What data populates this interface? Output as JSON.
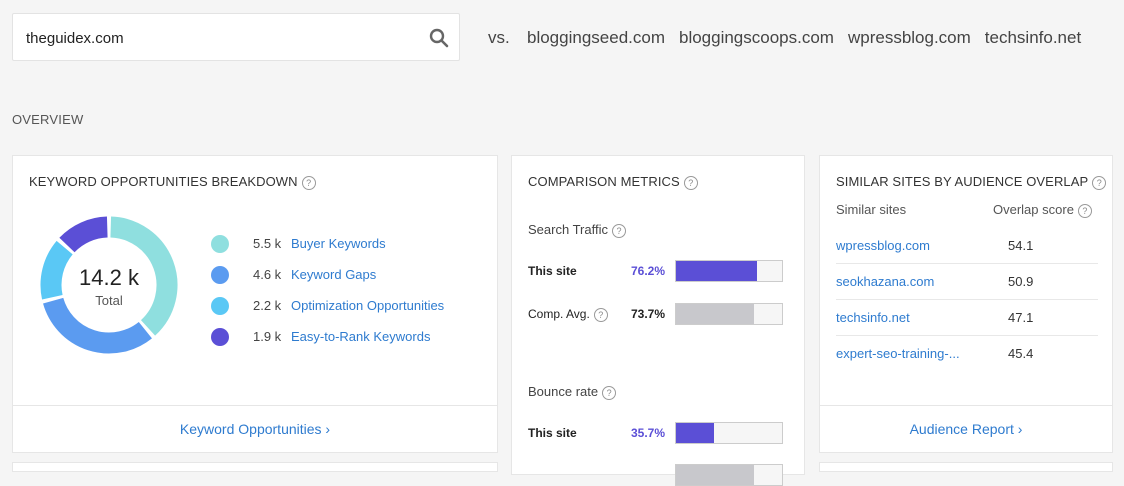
{
  "search": {
    "value": "theguidex.com"
  },
  "compare": {
    "vs_label": "vs.",
    "sites": [
      "bloggingseed.com",
      "bloggingscoops.com",
      "wpressblog.com",
      "techsinfo.net"
    ]
  },
  "overview_label": "OVERVIEW",
  "keyword_card": {
    "title": "KEYWORD OPPORTUNITIES BREAKDOWN",
    "total_value": "14.2 k",
    "total_label": "Total",
    "items": [
      {
        "value": "5.5 k",
        "label": "Buyer Keywords",
        "share": 5.5,
        "color": "#8fdfdf"
      },
      {
        "value": "4.6 k",
        "label": "Keyword Gaps",
        "share": 4.6,
        "color": "#5b9bf0"
      },
      {
        "value": "2.2 k",
        "label": "Optimization Opportunities",
        "share": 2.2,
        "color": "#5ac8f5"
      },
      {
        "value": "1.9 k",
        "label": "Easy-to-Rank Keywords",
        "share": 1.9,
        "color": "#5b4fd6"
      }
    ],
    "footer": "Keyword Opportunities ›"
  },
  "comparison_card": {
    "title": "COMPARISON METRICS",
    "metrics": [
      {
        "label": "Search Traffic",
        "this_site_label": "This site",
        "this_site_value": "76.2%",
        "this_site_fraction": 0.762,
        "comp_label": "Comp. Avg.",
        "comp_value": "73.7%",
        "comp_fraction": 0.737
      },
      {
        "label": "Bounce rate",
        "this_site_label": "This site",
        "this_site_value": "35.7%",
        "this_site_fraction": 0.357,
        "comp_fraction": 0.737
      }
    ],
    "colors": {
      "this_site": "#5b4fd6",
      "comp": "#c8c8cc"
    }
  },
  "similar_card": {
    "title": "SIMILAR SITES BY AUDIENCE OVERLAP",
    "col_site": "Similar sites",
    "col_score": "Overlap score",
    "rows": [
      {
        "site": "wpressblog.com",
        "score": "54.1"
      },
      {
        "site": "seokhazana.com",
        "score": "50.9"
      },
      {
        "site": "techsinfo.net",
        "score": "47.1"
      },
      {
        "site": "expert-seo-training-...",
        "score": "45.4"
      }
    ],
    "footer": "Audience Report ›"
  }
}
